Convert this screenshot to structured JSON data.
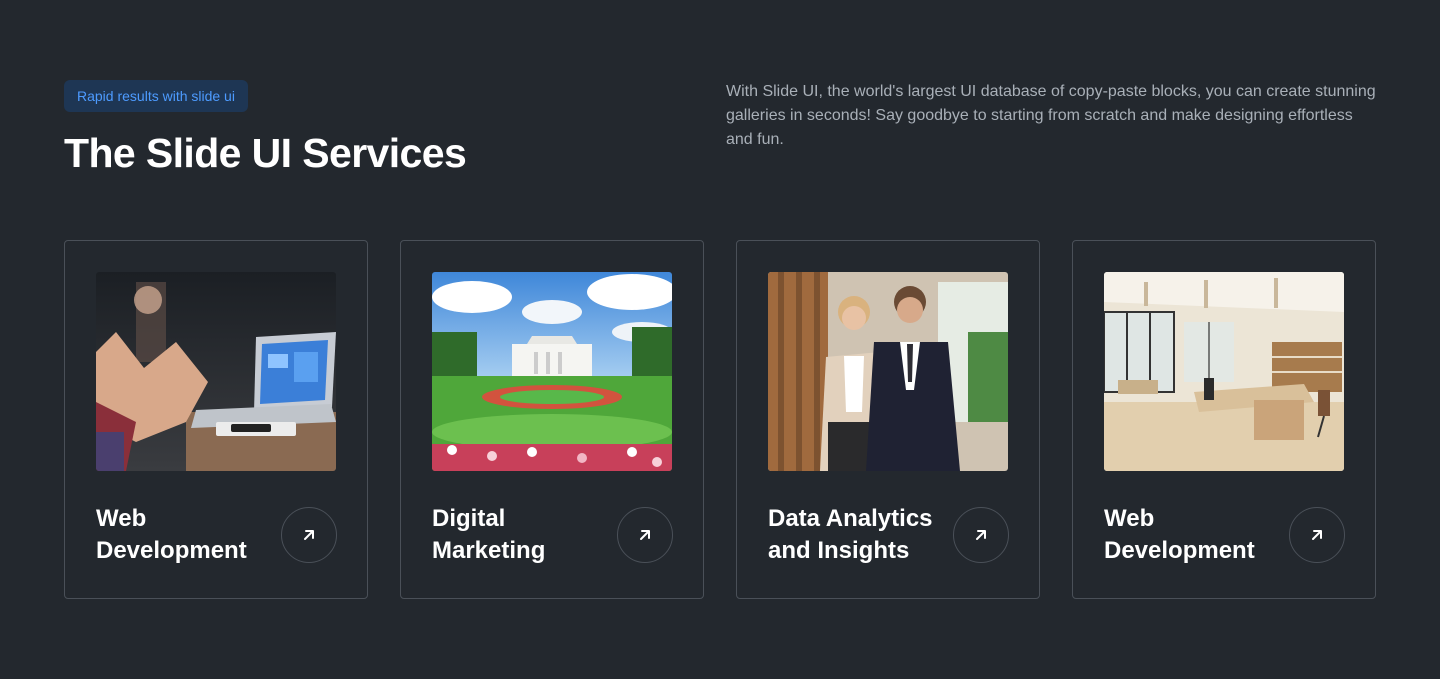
{
  "header": {
    "badge": "Rapid results with slide ui",
    "title": "The Slide UI Services",
    "description": "With Slide UI, the world's largest UI database of copy-paste blocks, you can create stunning galleries in seconds! Say goodbye to starting from scratch and make designing effortless and fun."
  },
  "colors": {
    "background": "#23282e",
    "accent": "#4d9bff",
    "badge_bg": "#1e3654",
    "card_border": "#4a5058",
    "text_primary": "#ffffff",
    "text_secondary": "#a9b0b8"
  },
  "cards": [
    {
      "title": "Web Development",
      "image": "laptop-meeting-photo",
      "icon": "arrow-up-right-icon"
    },
    {
      "title": "Digital Marketing",
      "image": "white-house-garden-photo",
      "icon": "arrow-up-right-icon"
    },
    {
      "title": "Data Analytics and Insights",
      "image": "business-people-photo",
      "icon": "arrow-up-right-icon"
    },
    {
      "title": "Web Development",
      "image": "modern-office-photo",
      "icon": "arrow-up-right-icon"
    }
  ]
}
